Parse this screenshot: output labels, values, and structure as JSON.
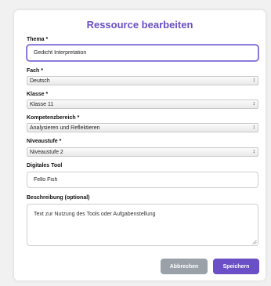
{
  "modal": {
    "title": "Ressource bearbeiten"
  },
  "fields": {
    "thema": {
      "label": "Thema *",
      "value": "Gedicht Interpretation"
    },
    "fach": {
      "label": "Fach *",
      "value": "Deutsch"
    },
    "klasse": {
      "label": "Klasse *",
      "value": "Klasse 11"
    },
    "kompetenzbereich": {
      "label": "Kompetenzbereich *",
      "value": "Analysieren und Reflektieren"
    },
    "niveaustufe": {
      "label": "Niveaustufe *",
      "value": "Niveaustufe 2"
    },
    "digitales_tool": {
      "label": "Digitales Tool",
      "value": "Fello Fish"
    },
    "beschreibung": {
      "label": "Beschreibung (optional)",
      "value": "Text zur Nutzung des Tools oder Aufgabenstellung"
    }
  },
  "buttons": {
    "cancel": "Abbrechen",
    "save": "Speichern"
  },
  "colors": {
    "accent": "#6a4fc6",
    "cancel": "#9aa1a9",
    "focus_border": "#7460cf"
  },
  "icons": {
    "select_arrow": "up-down-chevron-icon",
    "resize": "resize-grip-icon"
  }
}
